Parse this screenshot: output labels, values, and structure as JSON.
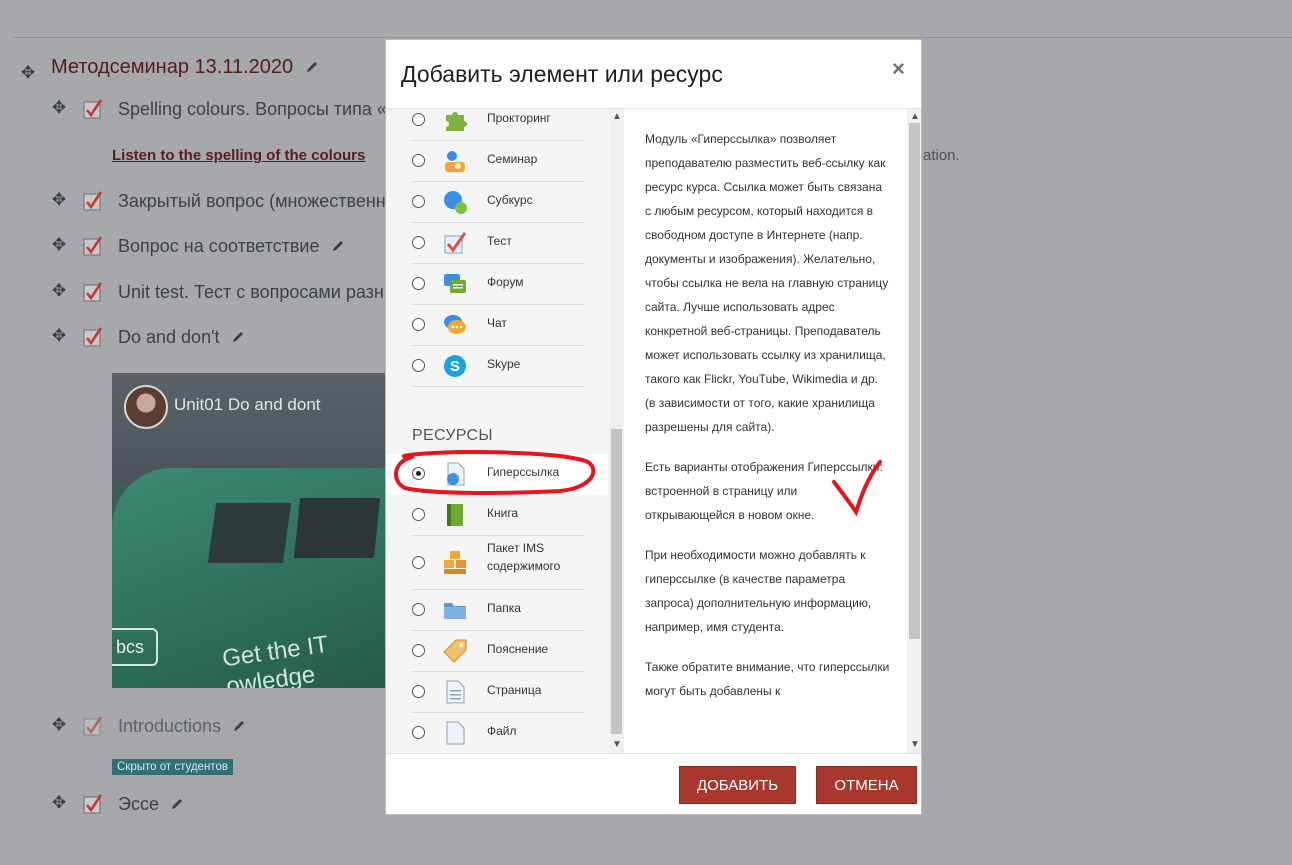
{
  "course": {
    "section_title": "Методсеминар 13.11.2020",
    "activities": [
      {
        "label": "Spelling colours. Вопросы типа «"
      },
      {
        "label": "Закрытый вопрос (множественн"
      },
      {
        "label": "Вопрос на соответствие"
      },
      {
        "label": "Unit test. Тест с вопросами разн"
      },
      {
        "label": "Do and don't"
      },
      {
        "label": "Introductions"
      },
      {
        "label": "Эссе"
      }
    ],
    "link_text": "Listen to the spelling of the colours",
    "trailing_text": "ation.",
    "video_title": "Unit01 Do and dont",
    "video_slogan": "Get the IT",
    "video_slogan2": "owledge",
    "video_logo": "bcs",
    "hidden_badge": "Скрыто от студентов"
  },
  "modal": {
    "title": "Добавить элемент или ресурс",
    "close_glyph": "×",
    "activities": [
      {
        "label": "Прокторинг",
        "icon": "puzzle-icon",
        "color": "#7cb342"
      },
      {
        "label": "Семинар",
        "icon": "workshop-icon",
        "color": "#f2a33a"
      },
      {
        "label": "Субкурс",
        "icon": "subcourse-icon",
        "color": "#3a8ee6"
      },
      {
        "label": "Тест",
        "icon": "quiz-icon",
        "color": "#d9533f"
      },
      {
        "label": "Форум",
        "icon": "forum-icon",
        "color": "#6cab2f"
      },
      {
        "label": "Чат",
        "icon": "chat-icon",
        "color": "#f0a830"
      },
      {
        "label": "Skype",
        "icon": "skype-icon",
        "color": "#1aa1e1"
      }
    ],
    "resources_header": "РЕСУРСЫ",
    "resources": [
      {
        "label": "Гиперссылка",
        "icon": "url-icon",
        "selected": true
      },
      {
        "label": "Книга",
        "icon": "book-icon"
      },
      {
        "label": "Пакет IMS",
        "label2": "содержимого",
        "icon": "ims-package-icon"
      },
      {
        "label": "Папка",
        "icon": "folder-icon"
      },
      {
        "label": "Пояснение",
        "icon": "label-icon"
      },
      {
        "label": "Страница",
        "icon": "page-icon"
      },
      {
        "label": "Файл",
        "icon": "file-icon"
      }
    ],
    "description": [
      "Модуль «Гиперссылка» позволяет преподавателю разместить веб-ссылку как ресурс курса. Ссылка может быть связана с любым ресурсом, который находится в свободном доступе в Интернете (напр. документы и изображения). Желательно, чтобы ссылка не вела на главную страницу сайта. Лучше использовать адрес конкретной веб-страницы. Преподаватель может использовать ссылку из хранилища, такого как Flickr, YouTube, Wikimedia и др. (в зависимости от того, какие хранилища разрешены для сайта).",
      "Есть варианты отображения Гиперссылки: встроенной в страницу или открывающейся в новом окне.",
      "При необходимости можно добавлять к гиперссылке (в качестве параметра запроса) дополнительную информацию, например, имя студента.",
      "Также обратите внимание, что гиперссылки могут быть добавлены к"
    ],
    "add_button": "ДОБАВИТЬ",
    "cancel_button": "ОТМЕНА"
  },
  "colors": {
    "button": "#a8382d",
    "annotation": "#e8141c",
    "overlay": "#a6a8ab"
  }
}
